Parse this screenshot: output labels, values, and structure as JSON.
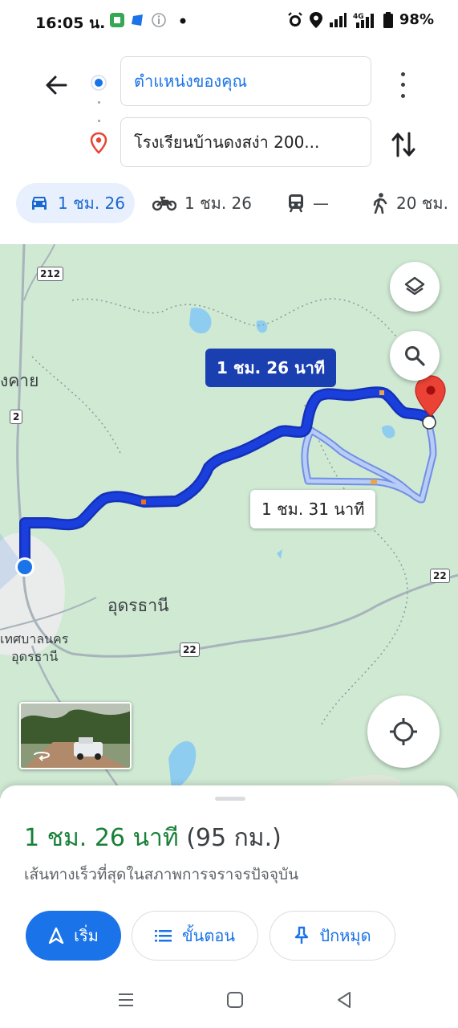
{
  "status_bar": {
    "time": "16:05 น.",
    "battery": "98%",
    "network": "4G"
  },
  "directions": {
    "origin": "ตำแหน่งของคุณ",
    "destination": "โรงเรียนบ้านดงสง่า 200..."
  },
  "modes": [
    {
      "icon": "car-icon",
      "label": "1 ชม. 26",
      "selected": true
    },
    {
      "icon": "motorcycle-icon",
      "label": "1 ชม. 26",
      "selected": false
    },
    {
      "icon": "transit-icon",
      "label": "—",
      "selected": false
    },
    {
      "icon": "walk-icon",
      "label": "20 ชม.",
      "selected": false
    }
  ],
  "map": {
    "labels": {
      "udon_thani": "อุดรธานี",
      "nong_khai_partial": "งคาย",
      "municipality_line1": "เทศบาลนคร",
      "municipality_line2": "อุดรธานี"
    },
    "road_shields": [
      "212",
      "2",
      "22",
      "22"
    ],
    "route_main_label": "1 ชม. 26 นาที",
    "route_alt_label": "1 ชม. 31 นาที",
    "colors": {
      "route_main": "#1a3fdc",
      "route_alt": "#a9bff2",
      "destination_pin": "#ea4335",
      "land": "#cfe9d3",
      "water": "#8ecdf0"
    }
  },
  "summary": {
    "duration": "1 ชม. 26 นาที",
    "distance": "(95 กม.)",
    "subtitle": "เส้นทางเร็วที่สุดในสภาพการจราจรปัจจุบัน",
    "buttons": {
      "start": "เริ่ม",
      "steps": "ขั้นตอน",
      "pin": "ปักหมุด"
    }
  }
}
